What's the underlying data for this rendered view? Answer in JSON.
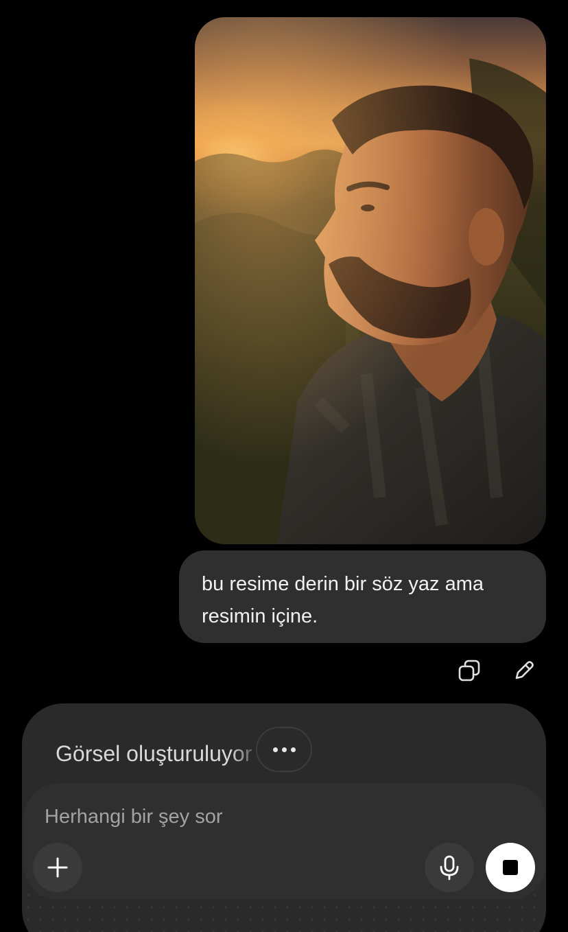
{
  "attachment": {
    "type": "image",
    "description_icon": "portrait-photo"
  },
  "user_message": {
    "line1": "bu resime derin bir söz yaz ama",
    "line2": "resimin içine."
  },
  "message_actions": {
    "copy_icon": "copy-icon",
    "edit_icon": "pencil-icon"
  },
  "generation": {
    "status_text": "Görsel oluşturuluyor",
    "more_icon": "ellipsis-icon"
  },
  "composer": {
    "placeholder": "Herhangi bir şey sor",
    "add_icon": "plus-icon",
    "mic_icon": "microphone-icon",
    "stop_icon": "stop-icon"
  },
  "colors": {
    "background": "#000000",
    "bubble": "#2f2f2f",
    "card": "#2a2a2a",
    "button_dark": "#3a3a3a",
    "button_light": "#ffffff"
  }
}
